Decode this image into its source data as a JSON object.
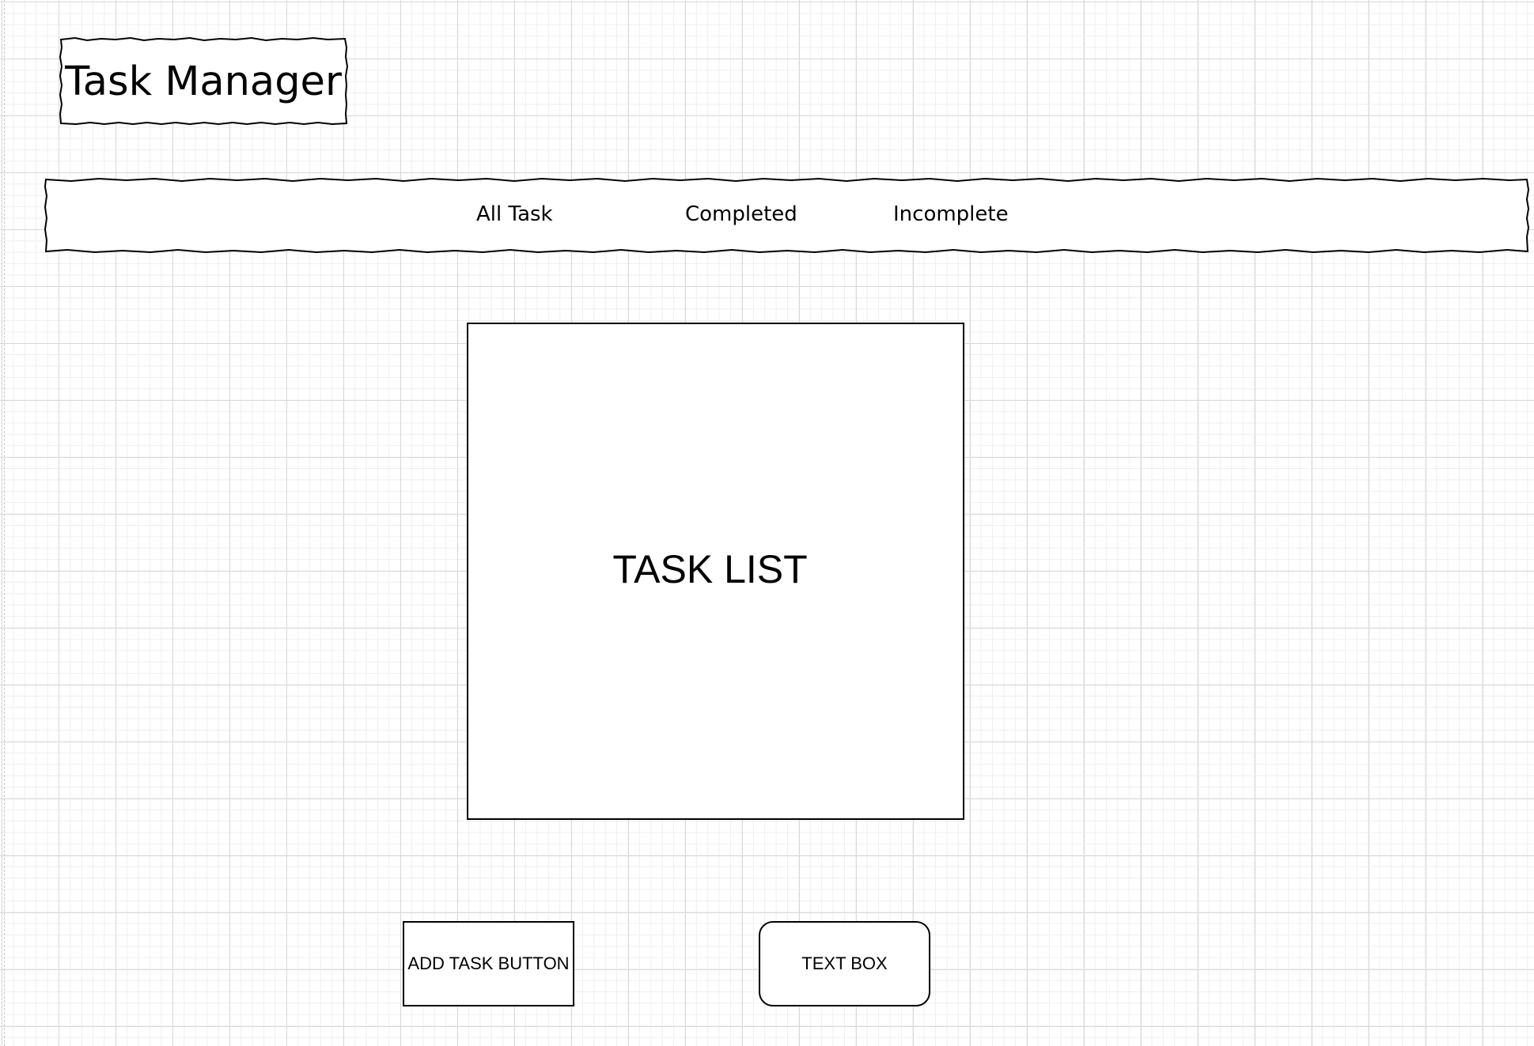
{
  "header": {
    "title": "Task Manager"
  },
  "nav": {
    "items": [
      "All Task",
      "Completed",
      "Incomplete"
    ]
  },
  "main": {
    "task_list_label": "TASK LIST"
  },
  "controls": {
    "add_task_label": "ADD TASK BUTTON",
    "text_box_label": "TEXT BOX"
  }
}
